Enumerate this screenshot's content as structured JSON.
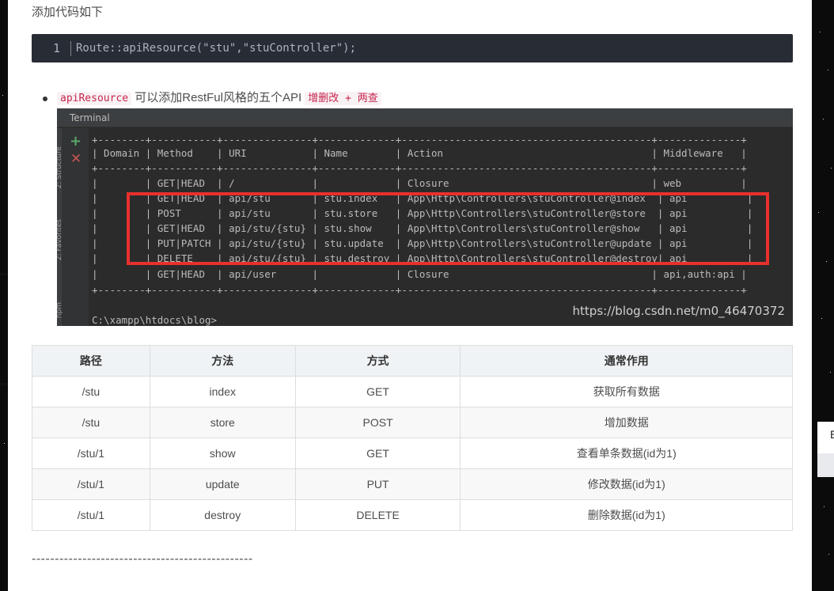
{
  "intro_text": "添加代码如下",
  "code_block": {
    "line_number": "1",
    "code": "Route::apiResource(\"stu\",\"stuController\");"
  },
  "bullet": {
    "code_term": "apiResource",
    "text": "可以添加RestFul风格的五个API",
    "highlight": "增删改 + 两查"
  },
  "terminal": {
    "title": "Terminal",
    "side_tabs": [
      "2: Structure",
      "2: Favorites",
      "npm"
    ],
    "lines": [
      "+--------+-----------+---------------+-------------+------------------------------------------+--------------+",
      "| Domain | Method    | URI           | Name        | Action                                   | Middleware   |",
      "+--------+-----------+---------------+-------------+------------------------------------------+--------------+",
      "|        | GET|HEAD  | /             |             | Closure                                  | web          |",
      "|        | GET|HEAD  | api/stu       | stu.index   | App\\Http\\Controllers\\stuController@index  | api          |",
      "|        | POST      | api/stu       | stu.store   | App\\Http\\Controllers\\stuController@store  | api          |",
      "|        | GET|HEAD  | api/stu/{stu} | stu.show    | App\\Http\\Controllers\\stuController@show   | api          |",
      "|        | PUT|PATCH | api/stu/{stu} | stu.update  | App\\Http\\Controllers\\stuController@update | api          |",
      "|        | DELETE    | api/stu/{stu} | stu.destroy | App\\Http\\Controllers\\stuController@destroy| api          |",
      "|        | GET|HEAD  | api/user      |             | Closure                                  | api,auth:api |",
      "+--------+-----------+---------------+-------------+------------------------------------------+--------------+",
      "",
      "C:\\xampp\\htdocs\\blog>"
    ],
    "watermark": "https://blog.csdn.net/m0_46470372"
  },
  "table": {
    "headers": [
      "路径",
      "方法",
      "方式",
      "通常作用"
    ],
    "rows": [
      [
        "/stu",
        "index",
        "GET",
        "获取所有数据"
      ],
      [
        "/stu",
        "store",
        "POST",
        "增加数据"
      ],
      [
        "/stu/1",
        "show",
        "GET",
        "查看单条数据(id为1)"
      ],
      [
        "/stu/1",
        "update",
        "PUT",
        "修改数据(id为1)"
      ],
      [
        "/stu/1",
        "destroy",
        "DELETE",
        "删除数据(id为1)"
      ]
    ]
  },
  "separator": "------------------------------------------------",
  "side_panel_glyph": "E"
}
